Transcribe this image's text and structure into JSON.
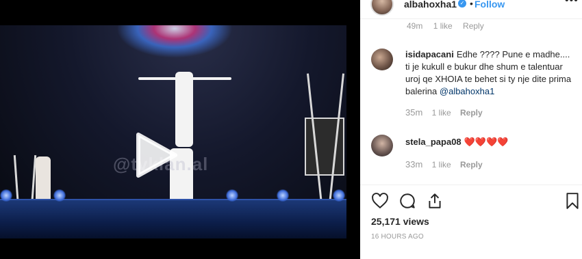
{
  "post": {
    "username": "albahoxha1",
    "verified_mark": "✓",
    "follow_label": "Follow",
    "more_icon": "ellipsis-icon",
    "separator": "•"
  },
  "video": {
    "watermark": "@tvklan.al",
    "play_icon": "play-icon"
  },
  "comments": [
    {
      "username": "isidapacani",
      "text": "Edhe ???? Pune e madhe.... ti je kukull e bukur dhe shum e talentuar uroj qe XHOIA te behet si ty nje dite prima balerina",
      "mention": "@albahoxha1",
      "time": "35m",
      "likes": "1 like",
      "reply": "Reply"
    },
    {
      "username": "stela_papa08",
      "text": "❤️❤️❤️❤️",
      "time": "33m",
      "likes": "1 like",
      "reply": "Reply"
    }
  ],
  "previous_meta": {
    "time": "49m",
    "likes": "1 like",
    "reply": "Reply"
  },
  "actions": {
    "like_icon": "heart-icon",
    "comment_icon": "comment-icon",
    "share_icon": "share-icon",
    "save_icon": "bookmark-icon"
  },
  "stats": {
    "views": "25,171 views",
    "posted": "16 HOURS AGO"
  }
}
